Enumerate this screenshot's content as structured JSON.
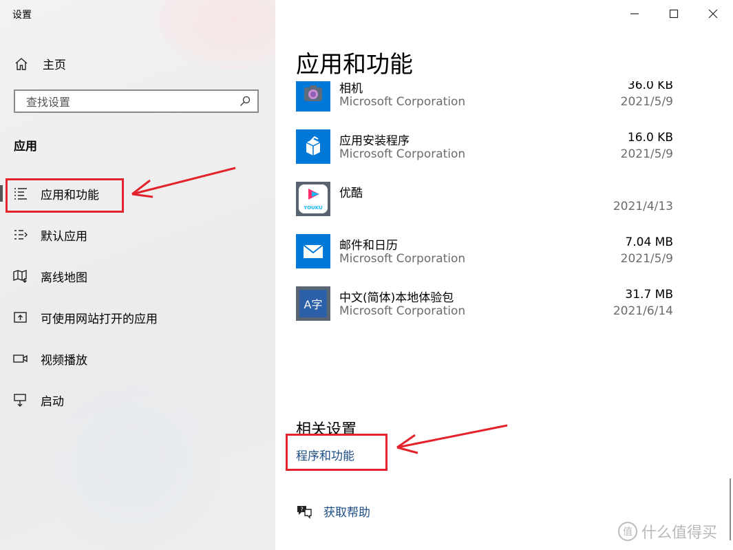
{
  "window": {
    "title": "设置"
  },
  "sidebar": {
    "home_label": "主页",
    "search_placeholder": "查找设置",
    "section_heading": "应用",
    "items": [
      {
        "label": "应用和功能",
        "icon": "list-icon",
        "active": true
      },
      {
        "label": "默认应用",
        "icon": "default-apps-icon"
      },
      {
        "label": "离线地图",
        "icon": "map-icon"
      },
      {
        "label": "可使用网站打开的应用",
        "icon": "open-web-icon"
      },
      {
        "label": "视频播放",
        "icon": "video-icon"
      },
      {
        "label": "启动",
        "icon": "startup-icon"
      }
    ]
  },
  "main": {
    "page_title": "应用和功能",
    "apps": [
      {
        "name": "相机",
        "publisher": "Microsoft Corporation",
        "size": "36.0 KB",
        "date": "2021/5/9",
        "icon": "camera-app-icon"
      },
      {
        "name": "应用安装程序",
        "publisher": "Microsoft Corporation",
        "size": "16.0 KB",
        "date": "2021/5/9",
        "icon": "app-installer-icon"
      },
      {
        "name": "优酷",
        "publisher": "",
        "size": "",
        "date": "2021/4/13",
        "icon": "youku-icon",
        "icon_text": "YOUKU"
      },
      {
        "name": "邮件和日历",
        "publisher": "Microsoft Corporation",
        "size": "7.04 MB",
        "date": "2021/5/9",
        "icon": "mail-icon"
      },
      {
        "name": "中文(简体)本地体验包",
        "publisher": "Microsoft Corporation",
        "size": "31.7 MB",
        "date": "2021/6/14",
        "icon": "language-pack-icon",
        "icon_text": "A字"
      }
    ],
    "related_heading": "相关设置",
    "related_link": "程序和功能",
    "help_label": "获取帮助"
  },
  "watermark": {
    "text": "什么值得买",
    "icon_text": "值"
  },
  "colors": {
    "accent": "#0078d7",
    "link": "#1c4e86",
    "annotation": "#e3222b",
    "secondary_text": "#6b6b6b"
  }
}
